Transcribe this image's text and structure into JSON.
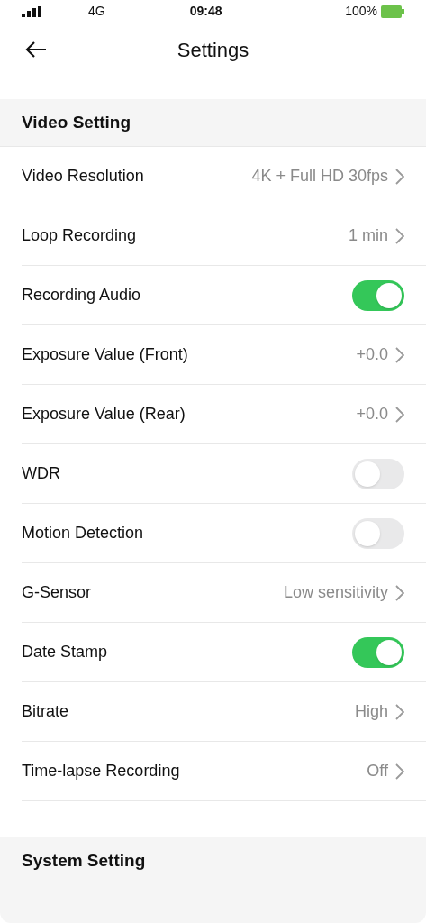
{
  "status_bar": {
    "network": "4G",
    "time": "09:48",
    "battery": "100%"
  },
  "header": {
    "title": "Settings"
  },
  "sections": [
    {
      "title": "Video Setting",
      "rows": [
        {
          "kind": "value",
          "label": "Video Resolution",
          "value": "4K + Full HD 30fps"
        },
        {
          "kind": "value",
          "label": "Loop Recording",
          "value": "1 min"
        },
        {
          "kind": "toggle",
          "label": "Recording Audio",
          "on": true
        },
        {
          "kind": "value",
          "label": "Exposure Value (Front)",
          "value": "+0.0"
        },
        {
          "kind": "value",
          "label": "Exposure Value (Rear)",
          "value": "+0.0"
        },
        {
          "kind": "toggle",
          "label": "WDR",
          "on": false
        },
        {
          "kind": "toggle",
          "label": "Motion Detection",
          "on": false
        },
        {
          "kind": "value",
          "label": "G-Sensor",
          "value": "Low sensitivity"
        },
        {
          "kind": "toggle",
          "label": "Date Stamp",
          "on": true
        },
        {
          "kind": "value",
          "label": "Bitrate",
          "value": "High"
        },
        {
          "kind": "value",
          "label": "Time-lapse Recording",
          "value": "Off"
        }
      ]
    },
    {
      "title": "System Setting"
    }
  ]
}
